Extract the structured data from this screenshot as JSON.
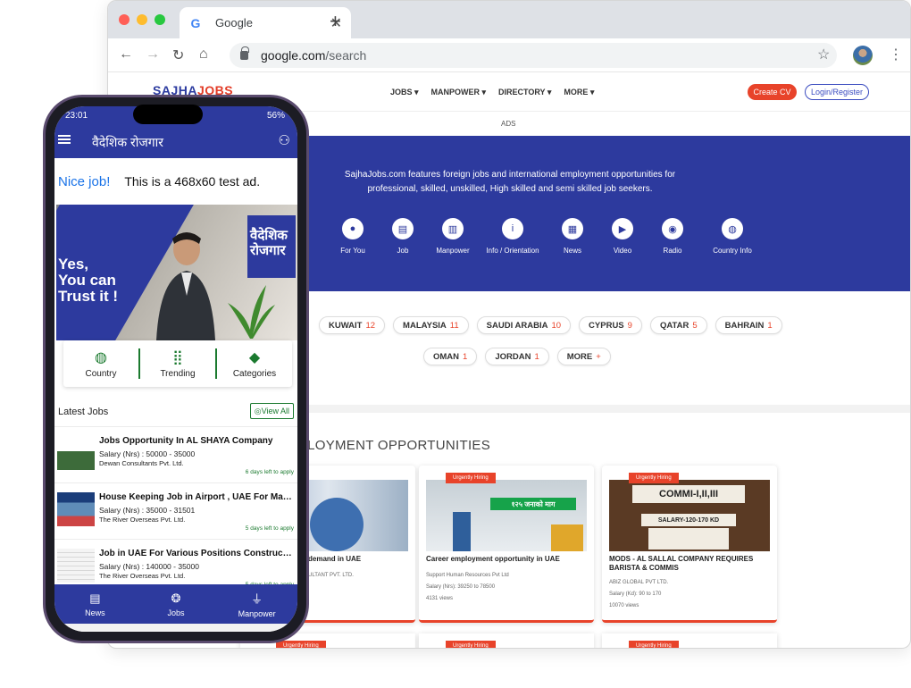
{
  "browser": {
    "tab_title": "Google",
    "new_tab": "+",
    "url_host": "google.com",
    "url_path": "/search"
  },
  "site": {
    "logo_main": "SAJHA",
    "logo_accent": "JOBS",
    "nav": [
      "JOBS ▾",
      "MANPOWER ▾",
      "DIRECTORY ▾",
      "MORE ▾"
    ],
    "create_cv": "Create CV",
    "login": "Login/Register",
    "ads_label": "ADS",
    "hero_text": "SajhaJobs.com features foreign jobs and international employment opportunities for professional, skilled, unskilled, High skilled and semi skilled job seekers.",
    "hero_categories": [
      "For You",
      "Job",
      "Manpower",
      "Info / Orientation",
      "News",
      "Video",
      "Radio",
      "Country Info"
    ],
    "countries_row1": [
      {
        "name": "KUWAIT",
        "count": "12"
      },
      {
        "name": "MALAYSIA",
        "count": "11"
      },
      {
        "name": "SAUDI ARABIA",
        "count": "10"
      },
      {
        "name": "CYPRUS",
        "count": "9"
      },
      {
        "name": "QATAR",
        "count": "5"
      },
      {
        "name": "BAHRAIN",
        "count": "1"
      }
    ],
    "countries_row2": [
      {
        "name": "OMAN",
        "count": "1"
      },
      {
        "name": "JORDAN",
        "count": "1"
      },
      {
        "name": "MORE",
        "count": "+"
      }
    ],
    "section_title": "MPLOYMENT OPPORTUNITIES",
    "cards": [
      {
        "badge": "",
        "title": "demand in UAE",
        "company": "ULTANT PVT. LTD.",
        "salary": "",
        "views": ""
      },
      {
        "badge": "Urgently Hiring",
        "title": "Career employment opportunity in UAE",
        "company": "Support Human Resources Pvt Ltd",
        "salary": "Salary (Nrs): 39250 to 78500",
        "views": "4131 views"
      },
      {
        "badge": "Urgently Hiring",
        "title": "MODS - AL SALLAL COMPANY REQUIRES BARISTA & COMMIS",
        "company": "ABIZ GLOBAL PVT LTD.",
        "salary": "Salary (Kd): 90 to 170",
        "views": "10070 views"
      }
    ],
    "card_texts": {
      "card2_banner": "१२५ जनाको माग",
      "card3_heading": "COMMI-I,II,III",
      "card3_salary": "SALARY-120-170 KD"
    },
    "bottom_badges": [
      "Urgently Hiring",
      "Urgently Hiring",
      "Urgently Hiring"
    ]
  },
  "phone": {
    "time": "23:01",
    "status_right": "56%",
    "app_title": "वैदेशिक रोजगार",
    "ad_nice": "Nice job!",
    "ad_text": "This is a 468x60 test ad.",
    "banner_text": [
      "Yes,",
      "You can",
      "Trust it !"
    ],
    "banner_logo": "वैदेशिक रोजगार",
    "quicknav": [
      {
        "label": "Country",
        "icon": "globe-icon"
      },
      {
        "label": "Trending",
        "icon": "chart-icon"
      },
      {
        "label": "Categories",
        "icon": "tag-icon"
      }
    ],
    "latest_title": "Latest Jobs",
    "view_all": "View All",
    "jobs": [
      {
        "title": "Jobs Opportunity In AL SHAYA Company",
        "salary": "Salary (Nrs) : 50000 - 35000",
        "company": "Dewan Consultants Pvt. Ltd.",
        "days": "6 days left to apply"
      },
      {
        "title": "House Keeping Job in Airport , UAE For Male...",
        "salary": "Salary (Nrs) : 35000 - 31501",
        "company": "The River Overseas Pvt. Ltd.",
        "days": "5 days left to apply"
      },
      {
        "title": "Job in UAE For Various Positions Constructio...",
        "salary": "Salary (Nrs) : 140000 - 35000",
        "company": "The River Overseas Pvt. Ltd.",
        "days": "5 days left to apply"
      }
    ],
    "bottom_nav": [
      "News",
      "Jobs",
      "Manpower"
    ]
  },
  "colors": {
    "brand_blue": "#2d3a9e",
    "accent_red": "#e8432a",
    "green": "#1b7a2f"
  }
}
